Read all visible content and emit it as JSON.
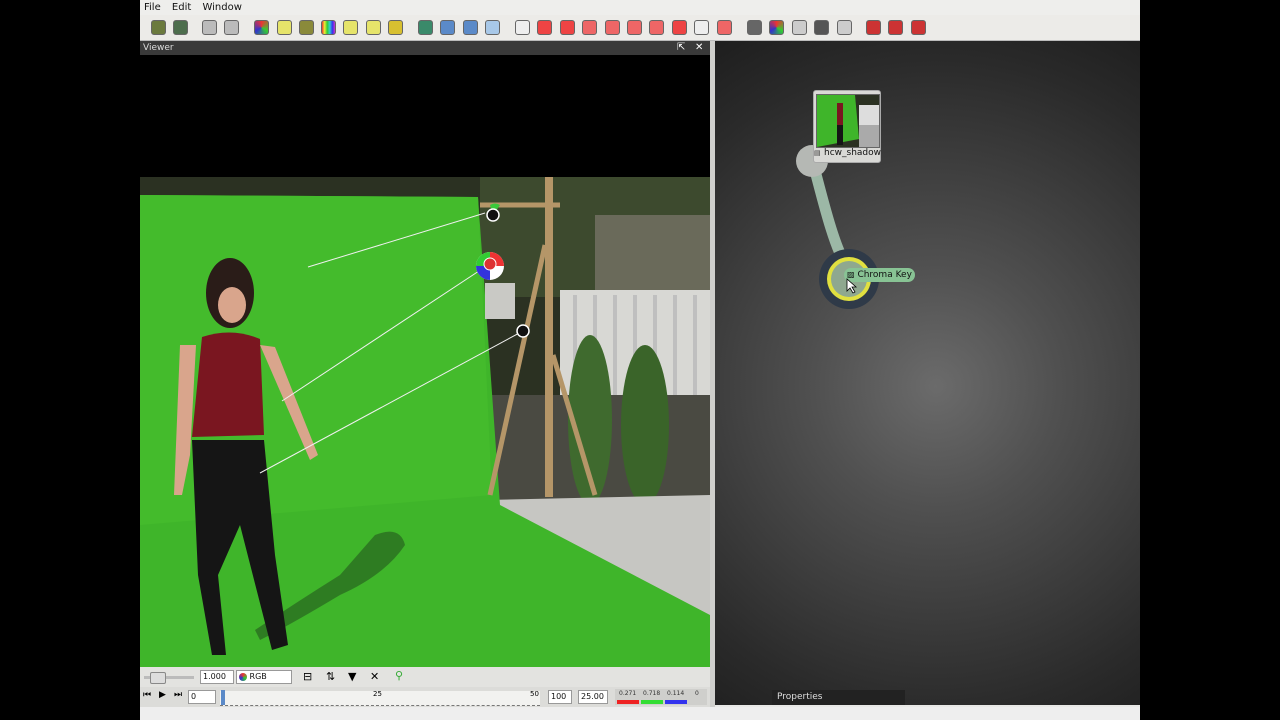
{
  "menu": {
    "file": "File",
    "edit": "Edit",
    "window": "Window"
  },
  "viewer": {
    "title": "Viewer"
  },
  "controls": {
    "zoom": "1.000",
    "channel": "RGB",
    "frame": "0",
    "end_frame": "100",
    "fps": "25.00",
    "ruler_labels": [
      "25",
      "50"
    ],
    "vals": [
      "0.271",
      "0.718",
      "0.114",
      "0"
    ]
  },
  "graph": {
    "source_node": "hcw_shadow",
    "key_node": "Chroma Key",
    "properties": "Properties"
  }
}
